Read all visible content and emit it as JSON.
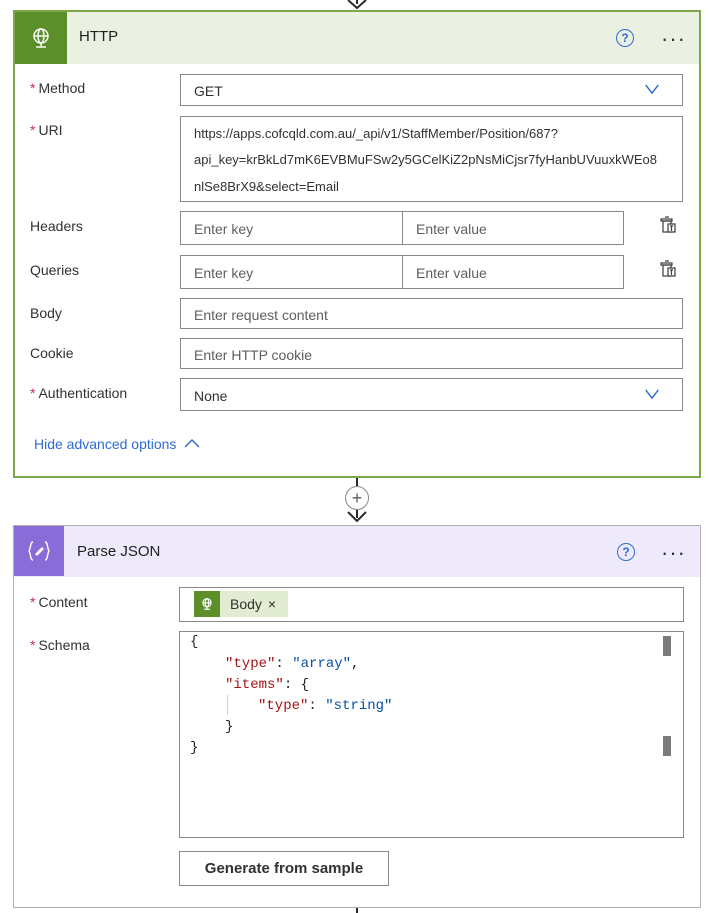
{
  "http_card": {
    "title": "HTTP",
    "help": "?",
    "method": {
      "label": "Method",
      "value": "GET"
    },
    "uri": {
      "label": "URI",
      "lines": [
        "https://apps.cofcqld.com.au/_api/v1/StaffMember/Position/687?",
        "api_key=krBkLd7mK6EVBMuFSw2y5GCelKiZ2pNsMiCjsr7fyHanbUVuuxkWEo8",
        "nlSe8BrX9&select=Email"
      ]
    },
    "headers": {
      "label": "Headers",
      "key_placeholder": "Enter key",
      "value_placeholder": "Enter value"
    },
    "queries": {
      "label": "Queries",
      "key_placeholder": "Enter key",
      "value_placeholder": "Enter value"
    },
    "body": {
      "label": "Body",
      "placeholder": "Enter request content"
    },
    "cookie": {
      "label": "Cookie",
      "placeholder": "Enter HTTP cookie"
    },
    "authentication": {
      "label": "Authentication",
      "value": "None"
    },
    "hide_advanced": "Hide advanced options"
  },
  "parse_json_card": {
    "title": "Parse JSON",
    "help": "?",
    "content": {
      "label": "Content",
      "token": "Body",
      "token_close": "×"
    },
    "schema": {
      "label": "Schema",
      "lines": [
        "{",
        "\"type\"",
        ": ",
        "\"array\"",
        ",",
        "\"items\"",
        ": {",
        "\"type\"",
        ": ",
        "\"string\"",
        "}",
        "}"
      ]
    },
    "generate_button": "Generate from sample"
  },
  "colors": {
    "http_accent": "#5c8f2a",
    "http_header_bg": "#eaf1e2",
    "json_accent": "#8a6cd9",
    "json_header_bg": "#eeeafb",
    "link": "#2f6bd6",
    "required": "#c4314b"
  },
  "icons": {
    "http": "globe-icon",
    "parse_json": "braces-icon",
    "help": "help-circle-icon",
    "more": "more-dots-icon",
    "dropdown": "chevron-down-icon",
    "delete": "trash-icon",
    "collapse": "chevron-up-icon",
    "add": "plus-circle-icon"
  }
}
